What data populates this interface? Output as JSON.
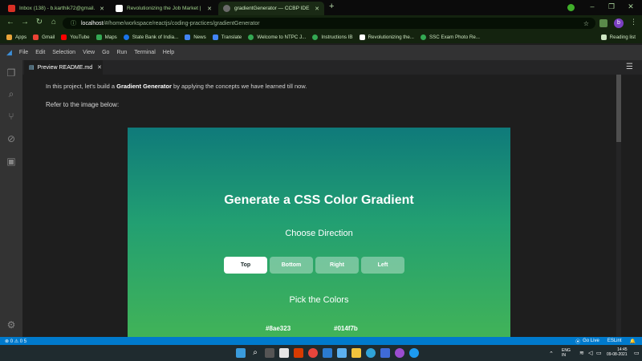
{
  "browser": {
    "tabs": [
      {
        "label": "Inbox (138) - b.karthik72@gmail.",
        "color": "#d93025"
      },
      {
        "label": "Revolutionizing the Job Market |",
        "color": "#ffffff"
      },
      {
        "label": "gradientGenerator — CCBP IDE",
        "color": "#6a6a6a"
      }
    ],
    "new_tab": "+",
    "url_host": "localhost",
    "url_path": "/#/home/workspace/reactjs/coding-practices/gradientGenerator",
    "profile_initial": "b",
    "bookmarks": [
      {
        "label": "Apps",
        "color": "#d93025"
      },
      {
        "label": "Gmail",
        "color": "#ea4335"
      },
      {
        "label": "YouTube",
        "color": "#ff0000"
      },
      {
        "label": "Maps",
        "color": "#34a853"
      },
      {
        "label": "State Bank of India...",
        "color": "#1a73e8"
      },
      {
        "label": "News",
        "color": "#4285f4"
      },
      {
        "label": "Translate",
        "color": "#4285f4"
      },
      {
        "label": "Welcome to NTPC J...",
        "color": "#34a853"
      },
      {
        "label": "Instructions IB",
        "color": "#34a853"
      },
      {
        "label": "Revolutionizing the...",
        "color": "#ffffff"
      },
      {
        "label": "SSC Exam Photo Re...",
        "color": "#34a853"
      }
    ],
    "reading_list": "Reading list"
  },
  "ide": {
    "menu": [
      "File",
      "Edit",
      "Selection",
      "View",
      "Go",
      "Run",
      "Terminal",
      "Help"
    ],
    "editor_tab": "Preview README.md",
    "intro_pre": "In this project, let's build a ",
    "intro_bold": "Gradient Generator",
    "intro_post": " by applying the concepts we have learned till now.",
    "refer": "Refer to the image below:",
    "status_left": "⊗ 0 ⚠ 0  5",
    "status_golive": "Go Live",
    "status_eslint": "ESLint"
  },
  "demo": {
    "title": "Generate a CSS Color Gradient",
    "choose_direction": "Choose Direction",
    "directions": [
      "Top",
      "Bottom",
      "Right",
      "Left"
    ],
    "active_direction": "Top",
    "pick_colors": "Pick the Colors",
    "color1": "#8ae323",
    "color2": "#014f7b"
  },
  "taskbar": {
    "lang": "ENG",
    "lang_region": "IN",
    "time": "14:45",
    "date": "09-08-2021"
  }
}
